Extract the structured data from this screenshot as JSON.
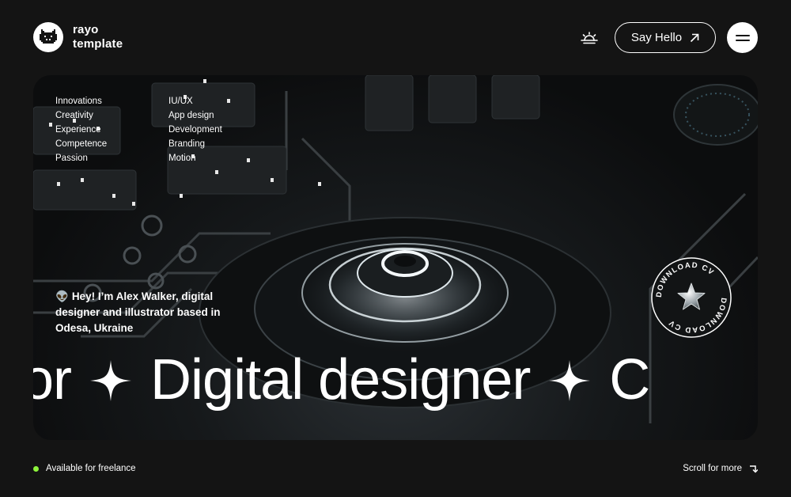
{
  "header": {
    "logo_line1": "rayo",
    "logo_line2": "template",
    "cta_label": "Say Hello",
    "icons": {
      "logo": "pixel-cat-icon",
      "theme": "sunrise-icon",
      "cta": "arrow-up-right-icon",
      "menu": "hamburger-icon"
    }
  },
  "hero": {
    "menu_left": [
      "Innovations",
      "Creativity",
      "Experience",
      "Competence",
      "Passion"
    ],
    "menu_right": [
      "IU/UX",
      "App design",
      "Development",
      "Branding",
      "Motion"
    ],
    "intro_emoji": "👽",
    "intro_text": "Hey! I’m Alex Walker, digital designer and illustrator based in Odesa, Ukraine",
    "marquee_prefix": "or",
    "marquee_main": "Digital designer",
    "marquee_suffix": "C",
    "download_label": "DOWNLOAD CV"
  },
  "footer": {
    "status_text": "Available for freelance",
    "scroll_text": "Scroll for more",
    "status_color": "#8ef43c"
  }
}
